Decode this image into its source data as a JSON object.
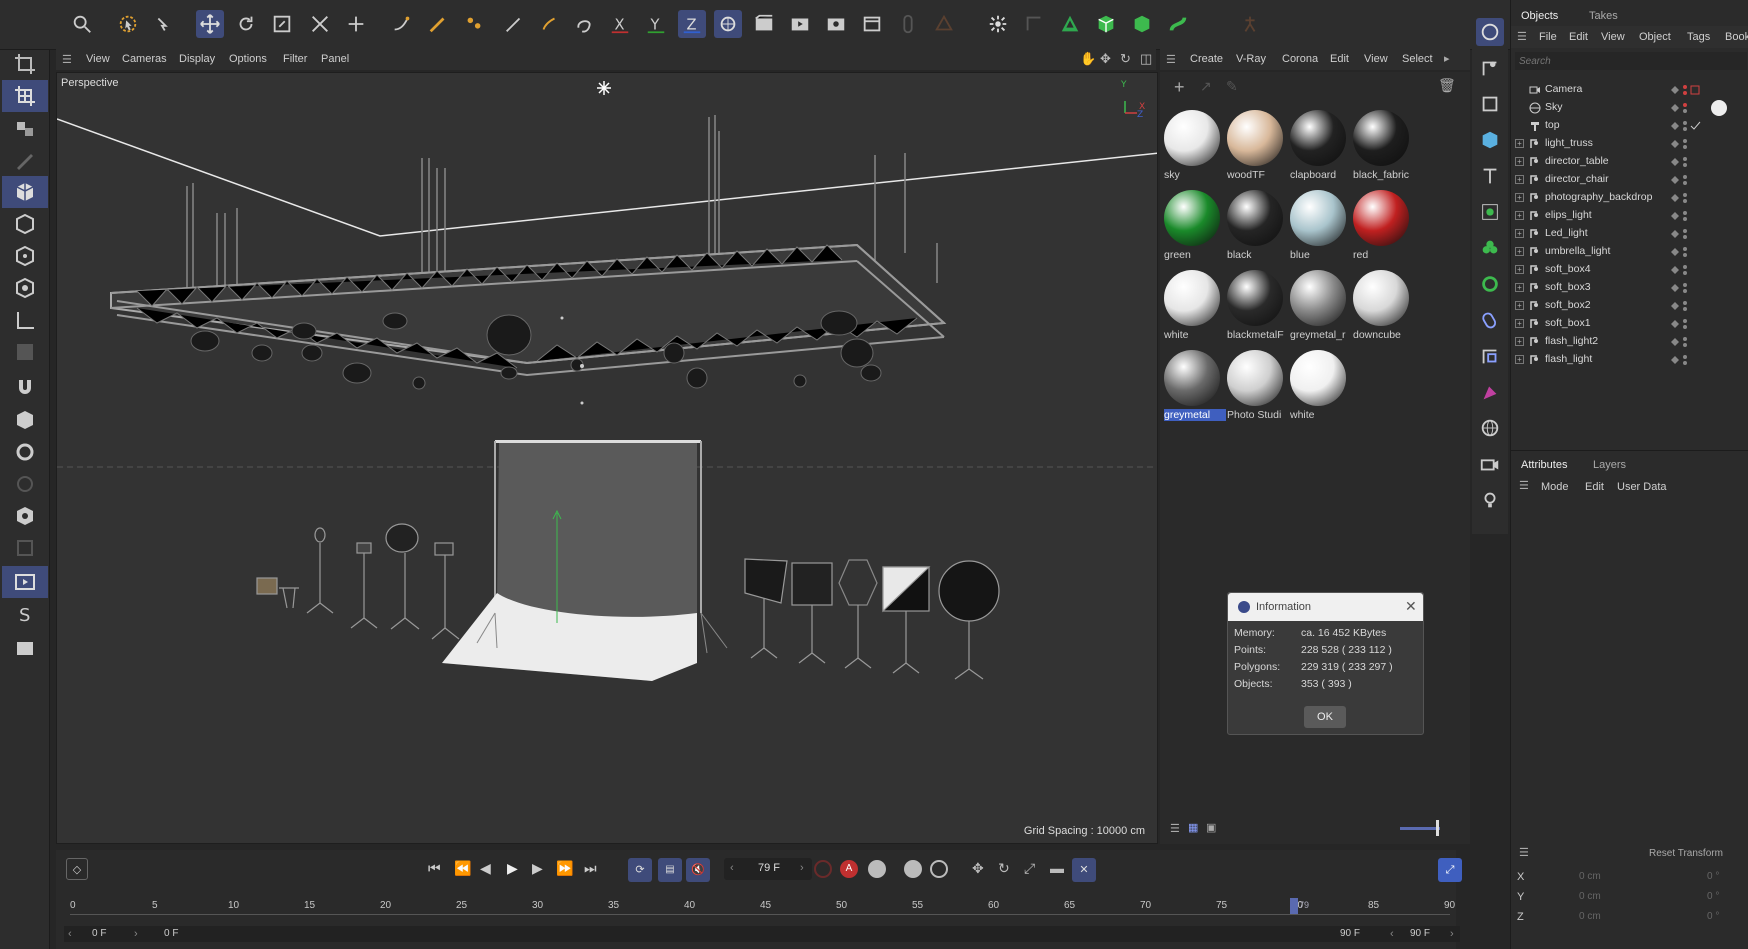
{
  "viewport": {
    "menu": [
      "View",
      "Cameras",
      "Display",
      "Options",
      "Filter",
      "Panel"
    ],
    "label": "Perspective",
    "grid_spacing": "Grid Spacing : 10000 cm"
  },
  "materials": {
    "menu": [
      "Create",
      "V-Ray",
      "Corona",
      "Edit",
      "View",
      "Select"
    ],
    "items": [
      {
        "name": "sky",
        "color": "#e8e8e8"
      },
      {
        "name": "woodTF",
        "color": "#d8b89a"
      },
      {
        "name": "clapboard",
        "color": "#222222"
      },
      {
        "name": "black_fabric",
        "color": "#1e1e1e"
      },
      {
        "name": "green",
        "color": "#1a8a2a"
      },
      {
        "name": "black",
        "color": "#252525"
      },
      {
        "name": "blue",
        "color": "#a9c4cc"
      },
      {
        "name": "red",
        "color": "#c02020"
      },
      {
        "name": "white",
        "color": "#e6e6e6"
      },
      {
        "name": "blackmetalF",
        "color": "#2a2a2a"
      },
      {
        "name": "greymetal_r",
        "color": "#8a8a8a"
      },
      {
        "name": "downcube",
        "color": "#d8d8d8"
      },
      {
        "name": "greymetal",
        "color": "#6a6a6a"
      },
      {
        "name": "Photo Studi",
        "color": "#cfcfcf"
      },
      {
        "name": "white",
        "color": "#f0f0f0"
      }
    ],
    "selected": "greymetal"
  },
  "objects": {
    "tabs": [
      "Objects",
      "Takes"
    ],
    "menu": [
      "File",
      "Edit",
      "View",
      "Object",
      "Tags",
      "Book"
    ],
    "search_placeholder": "Search",
    "items": [
      "Camera",
      "Sky",
      "top",
      "light_truss",
      "director_table",
      "director_chair",
      "photography_backdrop",
      "elips_light",
      "Led_light",
      "umbrella_light",
      "soft_box4",
      "soft_box3",
      "soft_box2",
      "soft_box1",
      "flash_light2",
      "flash_light"
    ]
  },
  "attributes": {
    "tabs": [
      "Attributes",
      "Layers"
    ],
    "menu": [
      "Mode",
      "Edit",
      "User Data"
    ]
  },
  "coordinates": {
    "reset_label": "Reset Transform",
    "rows": [
      {
        "axis": "X",
        "pos": "0 cm",
        "rot": "0 °"
      },
      {
        "axis": "Y",
        "pos": "0 cm",
        "rot": "0 °"
      },
      {
        "axis": "Z",
        "pos": "0 cm",
        "rot": "0 °"
      }
    ]
  },
  "timeline": {
    "current_frame": "79 F",
    "ticks": [
      "0",
      "5",
      "10",
      "15",
      "20",
      "25",
      "30",
      "35",
      "40",
      "45",
      "50",
      "55",
      "60",
      "65",
      "70",
      "75",
      "80",
      "85",
      "90"
    ],
    "playhead_label": "79",
    "start_frame": "0 F",
    "start_frame2": "0 F",
    "end_frame": "90 F",
    "end_frame2": "90 F"
  },
  "info_dialog": {
    "title": "Information",
    "rows": [
      {
        "key": "Memory:",
        "value": "ca. 16 452 KBytes"
      },
      {
        "key": "Points:",
        "value": "228 528 ( 233 112 )"
      },
      {
        "key": "Polygons:",
        "value": "229 319 ( 233 297 )"
      },
      {
        "key": "Objects:",
        "value": "353 ( 393 )"
      }
    ],
    "ok_label": "OK"
  },
  "toolbar": {
    "axis_x": "X",
    "axis_y": "Y",
    "axis_z": "Z"
  },
  "colors": {
    "accent": "#3f4b7a",
    "selection": "#3f5fbf"
  }
}
